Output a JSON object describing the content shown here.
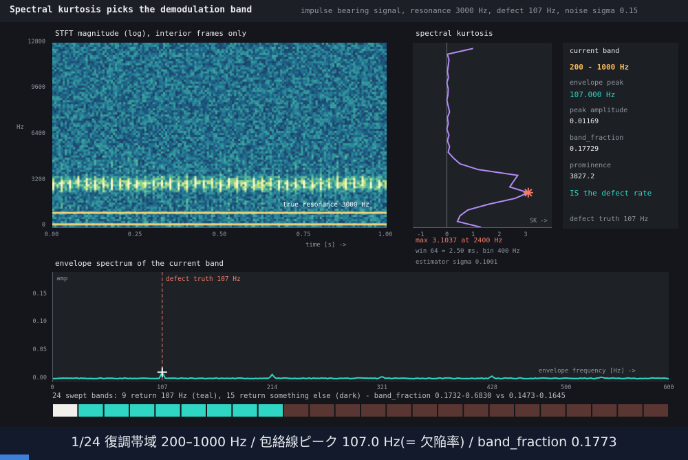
{
  "header": {
    "title": "Spectral kurtosis picks the demodulation band",
    "subtitle": "impulse bearing signal, resonance 3000 Hz, defect 107 Hz, noise sigma 0.15"
  },
  "stft": {
    "title": "STFT magnitude (log), interior frames only",
    "ylabel": "Hz",
    "xlabel": "time [s] ->",
    "yticks": [
      "12800",
      "9600",
      "6400",
      "3200",
      "0"
    ],
    "xticks": [
      "0.00",
      "0.25",
      "0.50",
      "0.75",
      "1.00"
    ],
    "annotation": "true resonance 3000 Hz"
  },
  "sk": {
    "title": "spectral kurtosis",
    "xticks": [
      "-1",
      "0",
      "1",
      "2",
      "3"
    ],
    "axis_tag": "SK ->",
    "max_text": "max 3.1037 at 2400 Hz",
    "win_text": "win 64 = 2.50 ms, bin 400 Hz",
    "sigma_text": "estimator sigma 0.1001"
  },
  "info": {
    "heading": "current band",
    "band": "200 - 1000 Hz",
    "env_label": "envelope peak",
    "env_value": "107.000 Hz",
    "amp_label": "peak amplitude",
    "amp_value": "0.01169",
    "bf_label": "band_fraction",
    "bf_value": "0.17729",
    "prom_label": "prominence",
    "prom_value": "3827.2",
    "verdict": "IS the defect rate",
    "truth": "defect truth 107 Hz"
  },
  "envelope": {
    "title": "envelope spectrum of the current band",
    "ylabel": "amp",
    "xlabel": "envelope frequency [Hz] ->",
    "truth_label": "defect truth 107 Hz",
    "yticks": [
      "0.15",
      "0.10",
      "0.05",
      "0.00"
    ],
    "xticks": [
      "0",
      "107",
      "214",
      "321",
      "428",
      "500",
      "600"
    ],
    "summary": "24 swept bands: 9 return 107 Hz (teal), 15 return something else (dark) - band_fraction 0.1732-0.6830 vs 0.1473-0.1645"
  },
  "caption": {
    "text": "1/24  復調帯域 200–1000 Hz  /  包絡線ピーク 107.0 Hz(= 欠陥率)  /  band_fraction 0.1773"
  },
  "progress": {
    "fraction": 0.0417
  },
  "colors": {
    "teal": "#2fd6c4",
    "accent_orange": "#f5b95a",
    "salmon": "#f07b6a",
    "sk_line": "#b38cf5",
    "dark_band": "#5a3632",
    "current_band": "#f2f0ea"
  },
  "chart_data": [
    {
      "type": "heatmap",
      "title": "STFT magnitude (log), interior frames only",
      "xlabel": "time [s] ->",
      "ylabel": "Hz",
      "xlim": [
        0,
        1
      ],
      "ylim": [
        0,
        12800
      ],
      "resonance_hz": 3000,
      "band_edges_hz": [
        200,
        1000
      ]
    },
    {
      "type": "line",
      "title": "spectral kurtosis",
      "xlabel": "SK ->",
      "xlim": [
        -1.3,
        4.0
      ],
      "ylim": [
        0,
        12800
      ],
      "freq_hz": [
        0,
        400,
        800,
        1200,
        1600,
        2000,
        2400,
        2800,
        3200,
        3600,
        4000,
        4400,
        4800,
        5200,
        5600,
        6000,
        6400,
        6800,
        7200,
        7600,
        8000,
        8400,
        8800,
        9200,
        9600,
        10000,
        10400,
        10800,
        11200,
        11600,
        12000,
        12400
      ],
      "sk": [
        1.3,
        0.4,
        0.5,
        0.8,
        1.6,
        2.6,
        3.1037,
        2.4,
        2.55,
        2.7,
        1.2,
        0.5,
        0.25,
        0.05,
        0.1,
        0.02,
        0.08,
        0.0,
        0.05,
        0.02,
        0.1,
        0.05,
        0.0,
        0.04,
        0.05,
        0.0,
        0.06,
        0.02,
        0.05,
        0.08,
        0.02,
        1.0
      ],
      "max": {
        "sk": 3.1037,
        "freq_hz": 2400
      }
    },
    {
      "type": "line",
      "title": "envelope spectrum of the current band",
      "xlabel": "envelope frequency [Hz] ->",
      "ylabel": "amp",
      "xlim": [
        0,
        600
      ],
      "ylim": [
        0,
        0.19
      ],
      "baseline": 0.0,
      "peaks": [
        {
          "x": 107,
          "y": 0.01169
        },
        {
          "x": 214,
          "y": 0.007
        },
        {
          "x": 321,
          "y": 0.004
        },
        {
          "x": 428,
          "y": 0.004
        },
        {
          "x": 535,
          "y": 0.003
        }
      ],
      "truth_x": 107
    },
    {
      "type": "bar",
      "title": "24 swept bands",
      "bands": [
        "current",
        "teal",
        "teal",
        "teal",
        "teal",
        "teal",
        "teal",
        "teal",
        "teal",
        "dark",
        "dark",
        "dark",
        "dark",
        "dark",
        "dark",
        "dark",
        "dark",
        "dark",
        "dark",
        "dark",
        "dark",
        "dark",
        "dark",
        "dark"
      ]
    }
  ]
}
